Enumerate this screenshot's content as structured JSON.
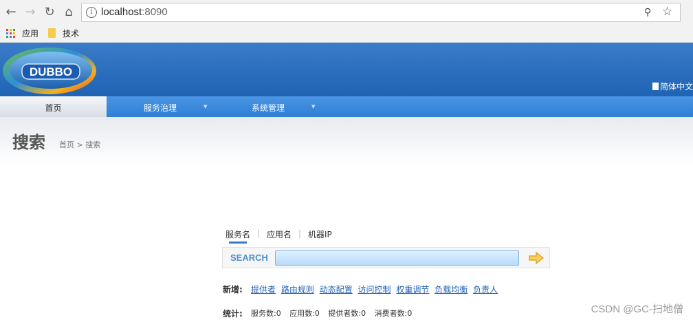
{
  "browser": {
    "url_host": "localhost",
    "url_port": ":8090",
    "bookmarks": [
      "应用",
      "技术"
    ]
  },
  "header": {
    "logo_text": "DUBBO",
    "language_label": "简体中文"
  },
  "menu": {
    "items": [
      {
        "label": "首页"
      },
      {
        "label": "服务治理"
      },
      {
        "label": "系统管理"
      }
    ]
  },
  "page": {
    "title": "搜索",
    "breadcrumb": "首页 > 搜索"
  },
  "search": {
    "tabs": [
      "服务名",
      "应用名",
      "机器IP"
    ],
    "separator": "|",
    "label": "SEARCH",
    "value": ""
  },
  "add_new": {
    "label": "新增:",
    "links": [
      "提供者",
      "路由规则",
      "动态配置",
      "访问控制",
      "权重调节",
      "负载均衡",
      "负责人"
    ]
  },
  "statistics": {
    "label": "统计:",
    "items": [
      "服务数:0",
      "应用数:0",
      "提供者数:0",
      "消费者数:0"
    ]
  },
  "watermark": "CSDN @GC-扫地僧",
  "colors": {
    "header_blue": "#1f63b4",
    "menu_blue": "#2f7fd6",
    "link_blue": "#2163b8"
  }
}
